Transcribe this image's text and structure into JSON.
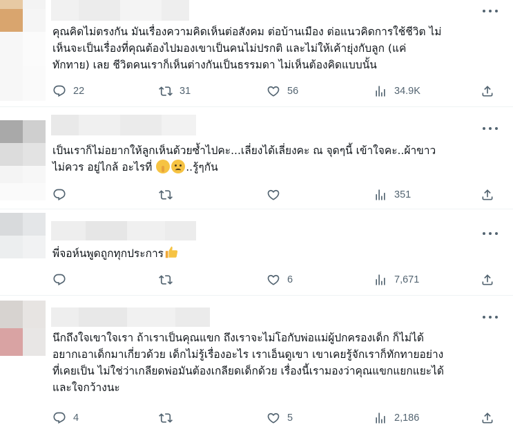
{
  "replies": [
    {
      "text_lines": [
        "คุณคิดไม่ตรงกัน มันเรื่องความคิดเห็นต่อสังคม ต่อบ้านเมือง ต่อแนวคิดการใช้ชีวิต ไม่",
        "เห็นจะเป็นเรื่องที่คุณต้องไปมองเขาเป็นคนไม่ปรกติ และไม่ให้เค้ายุ่งกับลูก (แค่",
        "ทักทาย) เลย ชีวิตคนเราก็เห็นต่างกันเป็นธรรมดา ไม่เห็นต้องคิดแบบนั้น"
      ],
      "reply_count": "22",
      "retweet_count": "31",
      "like_count": "56",
      "view_count": "34.9K"
    },
    {
      "text_lines": [
        "เป็นเราก็ไม่อยากให้ลูกเห็นด้วยซ้ำไปคะ...เลี่ยงได้เลี่ยงคะ ณ จุดๆนี้ เข้าใจคะ..ผ้าขาว",
        "ไม่ควร อยู่ไกล้ อะไรที่"
      ],
      "line2_suffix": "..รู้ๆกัน",
      "emojis": [
        "shushing-face-emoji",
        "worried-face-emoji"
      ],
      "reply_count": "",
      "retweet_count": "",
      "like_count": "",
      "view_count": "351"
    },
    {
      "text_lines": [
        "พี่จอห์นพูดถูกทุกประการ"
      ],
      "emojis": [
        "thumbs-up-emoji"
      ],
      "reply_count": "",
      "retweet_count": "",
      "like_count": "6",
      "view_count": "7,671"
    },
    {
      "text_lines": [
        "นึกถึงใจเขาใจเรา ถ้าเราเป็นคุณแขก ถึงเราจะไม่โอกับพ่อแม่ผู้ปกครองเด็ก ก็ไม่ได้",
        "อยากเอาเด็กมาเกี่ยวด้วย เด็กไม่รู้เรื่องอะไร เราเอ็นดูเขา เขาเคยรู้จักเราก็ทักทายอย่าง",
        "ที่เคยเป็น ไม่ใช่ว่าเกลียดพ่อมันต้องเกลียดเด็กด้วย เรื่องนี้เรามองว่าคุณแขกแยกแยะได้",
        "และใจกว้างนะ"
      ],
      "reply_count": "4",
      "retweet_count": "",
      "like_count": "5",
      "view_count": "2,186"
    }
  ],
  "icons": {
    "reply": "reply-icon",
    "retweet": "retweet-icon",
    "like": "heart-icon",
    "views": "analytics-icon",
    "share": "share-icon",
    "more": "more-options-icon"
  },
  "colors": {
    "text": "#0f1419",
    "muted": "#536471",
    "divider": "#eff3f4"
  }
}
